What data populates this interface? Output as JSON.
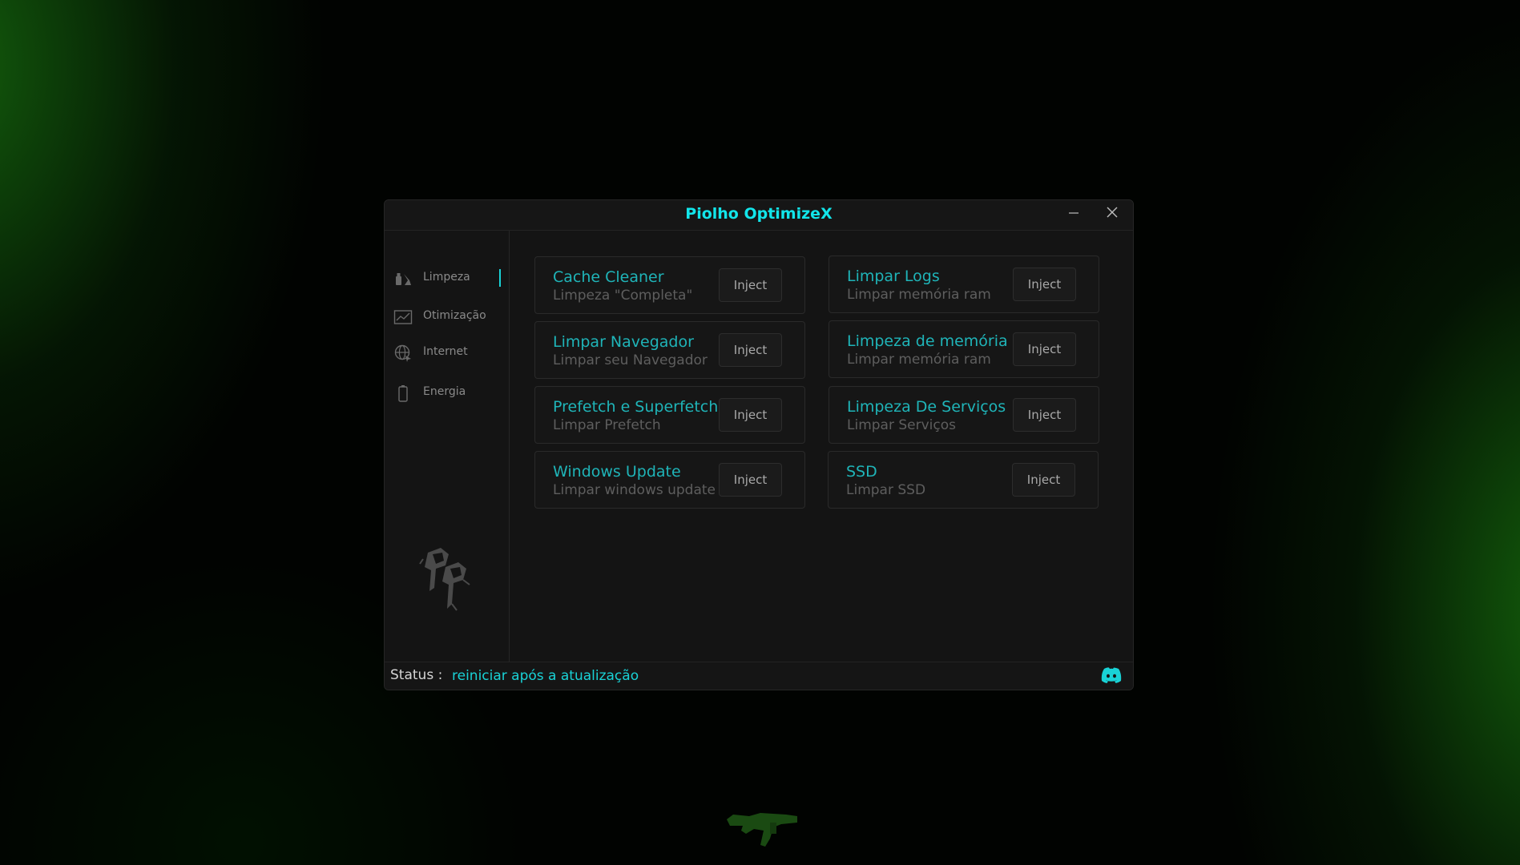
{
  "window": {
    "title": "Piolho OptimizeX"
  },
  "sidebar": {
    "items": [
      {
        "label": "Limpeza",
        "icon": "broom-icon",
        "active": true
      },
      {
        "label": "Otimização",
        "icon": "chart-icon",
        "active": false
      },
      {
        "label": "Internet",
        "icon": "globe-icon",
        "active": false
      },
      {
        "label": "Energia",
        "icon": "battery-icon",
        "active": false
      }
    ],
    "logo_icon": "pp-logo-icon"
  },
  "cards": [
    {
      "title": "Cache Cleaner",
      "subtitle": "Limpeza \"Completa\"",
      "button": "Inject"
    },
    {
      "title": "Limpar Logs",
      "subtitle": "Limpar memória ram",
      "button": "Inject"
    },
    {
      "title": "Limpar Navegador",
      "subtitle": "Limpar seu Navegador",
      "button": "Inject"
    },
    {
      "title": "Limpeza de memória",
      "subtitle": "Limpar memória ram",
      "button": "Inject"
    },
    {
      "title": "Prefetch e Superfetch",
      "subtitle": "Limpar Prefetch",
      "button": "Inject"
    },
    {
      "title": "Limpeza De Serviços",
      "subtitle": "Limpar Serviços",
      "button": "Inject"
    },
    {
      "title": "Windows Update",
      "subtitle": "Limpar windows update",
      "button": "Inject"
    },
    {
      "title": "SSD",
      "subtitle": "Limpar SSD",
      "button": "Inject"
    }
  ],
  "status": {
    "label": "Status :",
    "value": "reiniciar após a atualização"
  },
  "colors": {
    "accent": "#12e5ea",
    "card_title": "#1fb4b8",
    "background_green": "#18780e"
  }
}
